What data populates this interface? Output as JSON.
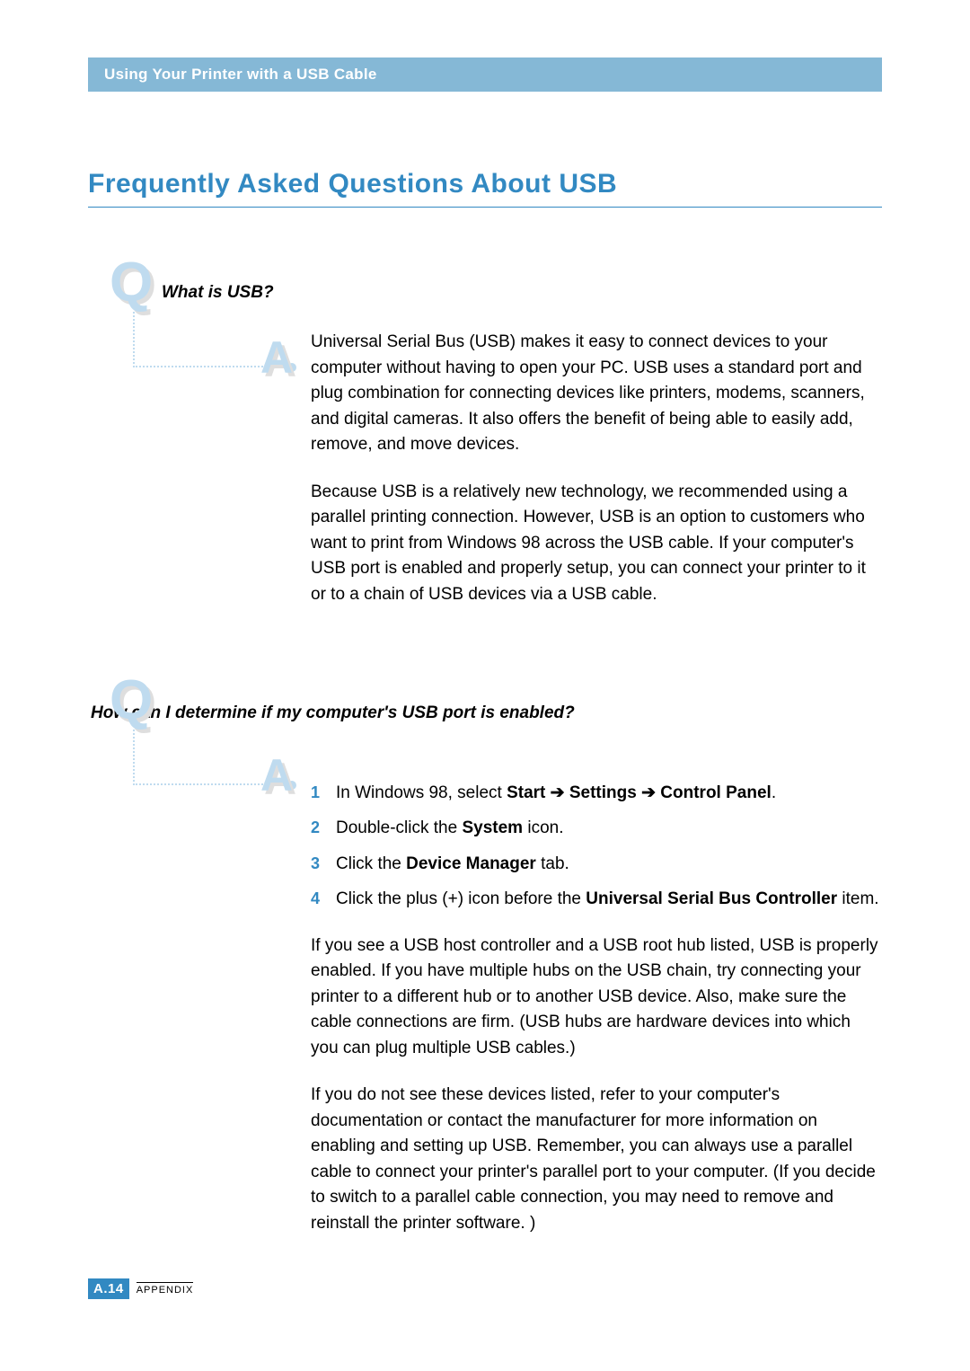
{
  "header_bar": "Using Your Printer with a USB Cable",
  "title": "Frequently Asked Questions About USB",
  "faq": [
    {
      "q_label": "Q",
      "a_label": "A",
      "question": "What is USB?",
      "paras": [
        "Universal Serial Bus (USB) makes it easy to connect devices to your computer without having to open your PC. USB uses a standard port and plug combination for connecting devices like printers, modems, scanners, and digital cameras. It also offers the benefit of being able to easily add, remove, and move devices.",
        "Because USB is a relatively new technology, we recommended using a parallel printing connection. However, USB is an option to customers who want to print from Windows 98 across the USB cable. If your computer's USB port is enabled and properly setup, you can connect your printer to it or to a chain of USB devices via a USB cable."
      ]
    },
    {
      "q_label": "Q",
      "a_label": "A",
      "question": "How can I determine if my computer's USB port is enabled?",
      "steps": [
        {
          "num": "1",
          "pre": "In Windows 98, select ",
          "bold": "Start ➔ Settings ➔ Control Panel",
          "post": "."
        },
        {
          "num": "2",
          "pre": "Double-click the ",
          "bold": "System",
          "post": " icon."
        },
        {
          "num": "3",
          "pre": "Click the ",
          "bold": "Device Manager",
          "post": " tab."
        },
        {
          "num": "4",
          "pre": "Click the plus (+) icon before the ",
          "bold": "Universal Serial Bus Controller",
          "post": " item."
        }
      ],
      "paras_after": [
        "If you see a USB host controller and a USB root hub listed, USB is properly enabled. If you have multiple hubs on the USB chain, try connecting your printer to a different hub or to another USB device. Also, make sure the cable connections are firm. (USB hubs are hardware devices into which you can plug multiple USB cables.)",
        "If you do not see these devices listed, refer to your computer's documentation or contact the manufacturer for more information on enabling and setting up USB. Remember, you can always use a parallel cable to connect your printer's parallel port to your computer. (If you decide to switch to a parallel cable connection, you may need to remove and reinstall the printer software. )"
      ]
    }
  ],
  "footer": {
    "page_prefix": "A.",
    "page_num": "14",
    "label": "APPENDIX"
  }
}
